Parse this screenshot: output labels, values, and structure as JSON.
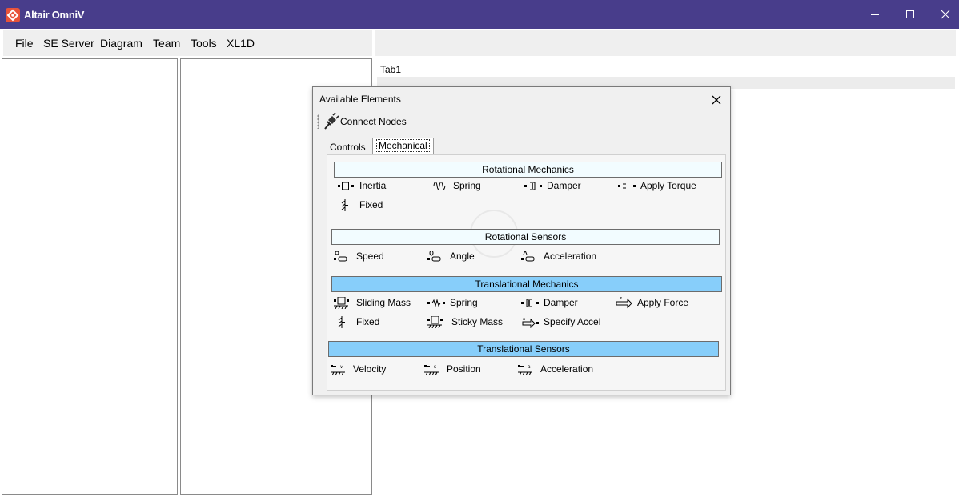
{
  "window": {
    "title": "Altair OmniV"
  },
  "menu": {
    "items": [
      "File",
      "SE Server",
      "Diagram",
      "Team",
      "Tools",
      "XL1D"
    ]
  },
  "editor": {
    "tab_label": "Tab1"
  },
  "dialog": {
    "title": "Available Elements",
    "toolbar_label": "Connect Nodes",
    "tabs": [
      "Controls",
      "Mechanical"
    ],
    "active_tab": "Mechanical",
    "sections": [
      {
        "title": "Rotational Mechanics",
        "header_color": "#f2fcff",
        "items": [
          "Inertia",
          "Spring",
          "Damper",
          "Apply Torque",
          "Fixed"
        ]
      },
      {
        "title": "Rotational Sensors",
        "header_color": "#f2fcff",
        "items": [
          "Speed",
          "Angle",
          "Acceleration"
        ]
      },
      {
        "title": "Translational Mechanics",
        "header_color": "#87cefa",
        "items": [
          "Sliding Mass",
          "Spring",
          "Damper",
          "Apply Force",
          "Fixed",
          "Sticky Mass",
          "Specify Accel"
        ]
      },
      {
        "title": "Translational Sensors",
        "header_color": "#87cefa",
        "items": [
          "Velocity",
          "Position",
          "Acceleration"
        ]
      }
    ]
  },
  "colors": {
    "titlebar": "#483d8b",
    "section_light": "#f2fcff",
    "section_blue": "#87cefa",
    "logo": "#e8533a"
  }
}
